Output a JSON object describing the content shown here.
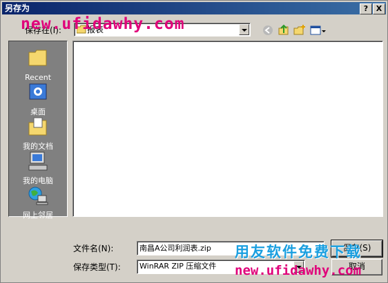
{
  "window": {
    "title": "另存为",
    "help_btn": "?",
    "close_btn": "X"
  },
  "save_in": {
    "label": "保存在(I):",
    "value": "报表"
  },
  "places": [
    {
      "label": "Recent"
    },
    {
      "label": "桌面"
    },
    {
      "label": "我的文档"
    },
    {
      "label": "我的电脑"
    },
    {
      "label": "网上邻居"
    }
  ],
  "filename": {
    "label": "文件名(N):",
    "value": "南昌A公司利润表.zip"
  },
  "filetype": {
    "label": "保存类型(T):",
    "value": "WinRAR ZIP 压缩文件"
  },
  "buttons": {
    "save": "保存(S)",
    "cancel": "取消"
  },
  "watermark": {
    "top": "new.ufidawhy.com",
    "bottom_cn": "用友软件免费下载",
    "bottom_url": "new.ufidawhy.com"
  },
  "colors": {
    "titlebar": "#0a246a",
    "dialog": "#d4d0c8",
    "watermark_pink": "#e0007a",
    "watermark_blue": "#1a9fe0"
  }
}
